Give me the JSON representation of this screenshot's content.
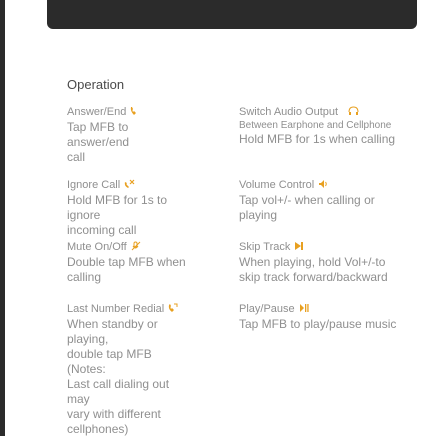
{
  "page": {
    "heading": "Operation"
  },
  "colors": {
    "accent_icon": "#e8a020",
    "text": "#8f8f8f",
    "heading_text": "#4a4a4a",
    "frame": "#2b2b2b"
  },
  "left": [
    {
      "title": "Answer/End",
      "icon": "phone-answer-icon",
      "desc": "Tap MFB to answer/end\ncall"
    },
    {
      "title": "Ignore Call",
      "icon": "ignore-call-icon",
      "desc": "Hold MFB for 1s to ignore\nincoming call"
    },
    {
      "title": "Mute On/Off",
      "icon": "mute-icon",
      "desc": "Double tap MFB when\ncalling"
    },
    {
      "title": "Last Number Redial",
      "icon": "redial-icon",
      "desc": "When standby or playing,\ndouble tap MFB (Notes:\nLast call dialing out may\nvary with different\ncellphones)"
    }
  ],
  "right": [
    {
      "title": "Switch Audio Output",
      "icon": "audio-switch-icon",
      "desc_small": "Between Earphone and Cellphone",
      "desc": "Hold MFB for 1s when calling"
    },
    {
      "title": "Volume Control",
      "icon": "volume-icon",
      "desc": "Tap vol+/- when calling or\nplaying"
    },
    {
      "title": "Skip Track",
      "icon": "skip-track-icon",
      "desc": "When playing, hold Vol+/-to\nskip track forward/backward"
    },
    {
      "title": "Play/Pause",
      "icon": "play-pause-icon",
      "desc": "Tap MFB to play/pause music"
    }
  ]
}
